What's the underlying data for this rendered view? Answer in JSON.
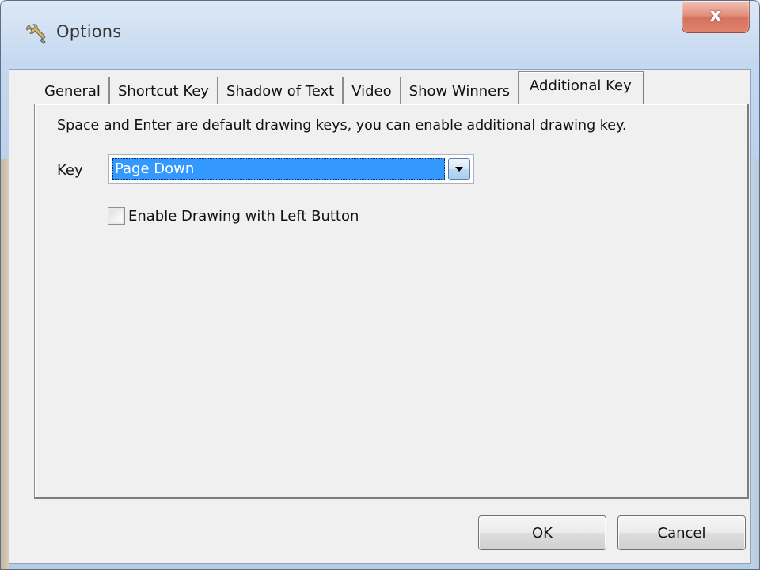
{
  "window": {
    "title": "Options",
    "title_icon": "wrench-icon",
    "close_label": "x"
  },
  "tabs": [
    {
      "label": "General",
      "active": false
    },
    {
      "label": "Shortcut Key",
      "active": false
    },
    {
      "label": "Shadow of Text",
      "active": false
    },
    {
      "label": "Video",
      "active": false
    },
    {
      "label": "Show Winners",
      "active": false
    },
    {
      "label": "Additional Key",
      "active": true
    }
  ],
  "panel": {
    "description": "Space and Enter are default drawing keys, you can enable additional drawing key.",
    "key_label": "Key",
    "key_value": "Page Down",
    "checkbox_label": "Enable Drawing with Left Button",
    "checkbox_checked": false
  },
  "buttons": {
    "ok": "OK",
    "cancel": "Cancel"
  },
  "colors": {
    "selection": "#3399ff",
    "close_button": "#c8432a",
    "frame": "#bcd1ea"
  }
}
